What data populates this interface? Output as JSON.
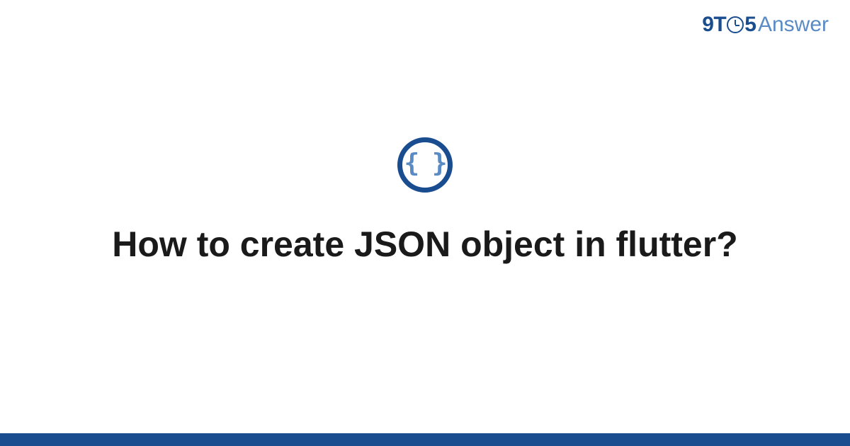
{
  "header": {
    "logo_part1": "9T",
    "logo_part2": "5",
    "logo_part3": "Answer"
  },
  "main": {
    "icon_name": "json-braces-icon",
    "icon_glyph": "{ }",
    "title": "How to create JSON object in flutter?"
  },
  "colors": {
    "brand_dark": "#1a4d8f",
    "brand_light": "#5a8bc4",
    "text": "#1a1a1a",
    "background": "#ffffff"
  }
}
